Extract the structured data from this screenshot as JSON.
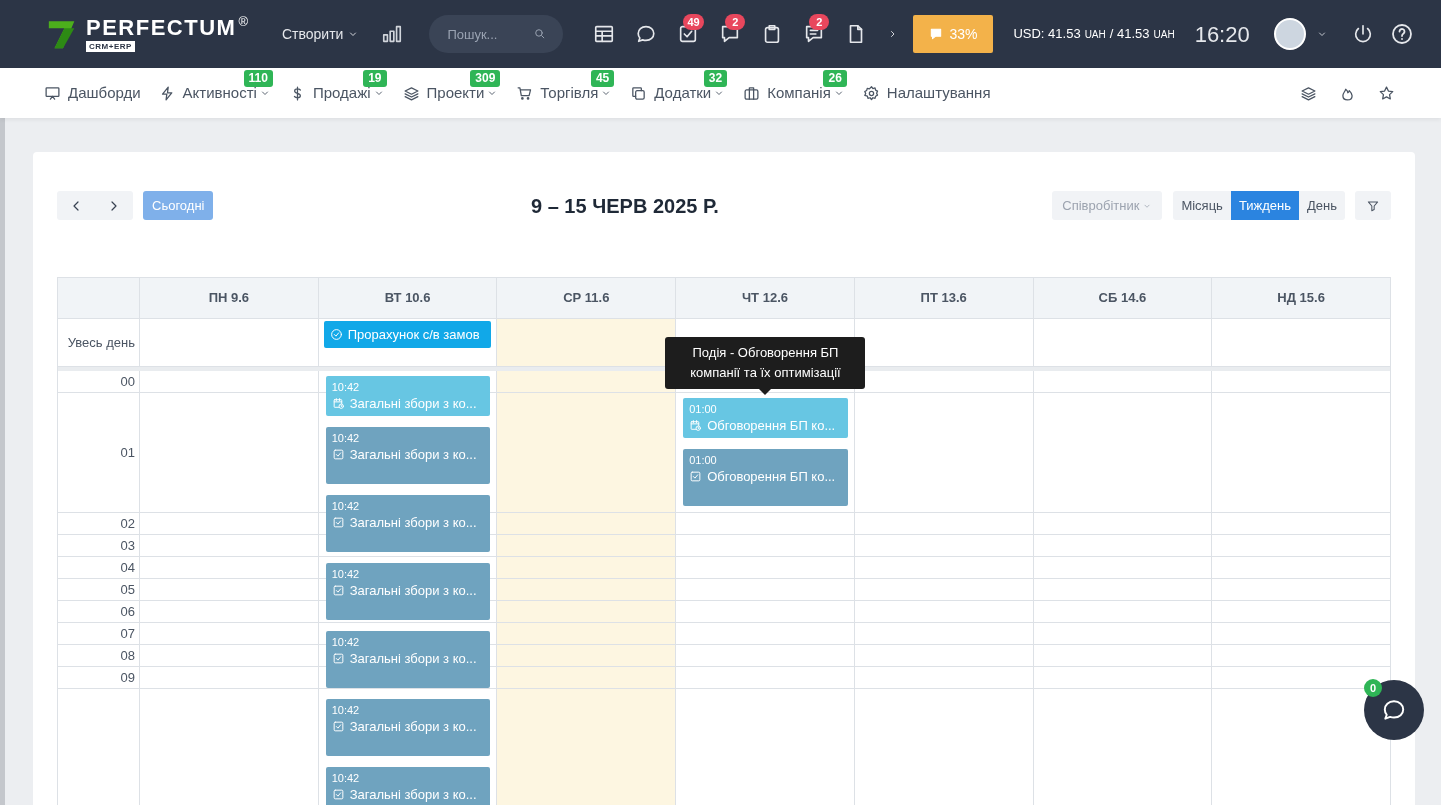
{
  "header": {
    "brand": "PERFECTUM",
    "brand_mark": "®",
    "brand_sub": "CRM+ERP",
    "create": "Створити",
    "search": {
      "placeholder": "Пошук..."
    },
    "icons": [
      {
        "kind": "table"
      },
      {
        "kind": "chat"
      },
      {
        "kind": "tasks",
        "badge": "49"
      },
      {
        "kind": "messages",
        "badge": "2"
      },
      {
        "kind": "clipboard"
      },
      {
        "kind": "notes",
        "badge": "2"
      },
      {
        "kind": "file"
      },
      {
        "kind": "more"
      }
    ],
    "progress": "33%",
    "currency": [
      {
        "amount": "USD: 41.53",
        "unit": "UAH"
      },
      {
        "amount": "/ 41.53",
        "unit": "UAH"
      }
    ],
    "time": "16:20"
  },
  "nav": [
    {
      "kind": "dashboard",
      "label": "Дашборди",
      "dropdown": false
    },
    {
      "kind": "bolt",
      "label": "Активності",
      "badge": "110",
      "dropdown": true
    },
    {
      "kind": "dollar",
      "label": "Продажі",
      "badge": "19",
      "dropdown": true
    },
    {
      "kind": "layers",
      "label": "Проекти",
      "badge": "309",
      "dropdown": true
    },
    {
      "kind": "cart",
      "label": "Торгівля",
      "badge": "45",
      "dropdown": true
    },
    {
      "kind": "copy",
      "label": "Додатки",
      "badge": "32",
      "dropdown": true
    },
    {
      "kind": "briefcase",
      "label": "Компанія",
      "badge": "26",
      "dropdown": true
    },
    {
      "kind": "gear",
      "label": "Налаштування",
      "dropdown": false
    }
  ],
  "calendar": {
    "today_button": "Сьогодні",
    "title": "9 – 15 ЧЕРВ 2025 Р.",
    "employee_filter": "Співробітник",
    "views": [
      {
        "label": "Місяць",
        "selected": false
      },
      {
        "label": "Тиждень",
        "selected": true
      },
      {
        "label": "День",
        "selected": false
      }
    ],
    "all_day_label": "Увесь день",
    "days": [
      {
        "label": "ПН 9.6",
        "today": false
      },
      {
        "label": "ВТ 10.6",
        "today": false,
        "all_day": [
          {
            "kind": "task",
            "title": "Прорахунок с/в замов"
          }
        ]
      },
      {
        "label": "СР 11.6",
        "today": true
      },
      {
        "label": "ЧТ 12.6",
        "today": false
      },
      {
        "label": "ПТ 13.6",
        "today": false
      },
      {
        "label": "СБ 14.6",
        "today": false
      },
      {
        "label": "НД 15.6",
        "today": false
      }
    ],
    "hours": [
      {
        "label": "00",
        "columns": [
          null,
          {
            "events": [
              {
                "kind": "event",
                "time": "10:42",
                "title": "Загальні збори з ко..."
              },
              {
                "kind": "task",
                "time": "10:42",
                "title": "Загальні збори з ко..."
              },
              {
                "kind": "task",
                "time": "10:42",
                "title": "Загальні збори з ко..."
              },
              {
                "kind": "task",
                "time": "10:42",
                "title": "Загальні збори з ко..."
              },
              {
                "kind": "task",
                "time": "10:42",
                "title": "Загальні збори з ко..."
              },
              {
                "kind": "task",
                "time": "10:42",
                "title": "Загальні збори з ко..."
              },
              {
                "kind": "task",
                "time": "10:42",
                "title": "Загальні збори з ко..."
              }
            ]
          },
          null,
          null,
          null,
          null,
          null
        ]
      },
      {
        "label": "01",
        "columns": [
          null,
          null,
          null,
          {
            "events": [
              {
                "kind": "event",
                "time": "01:00",
                "title": "Обговорення БП ко...",
                "tooltip": "Подія - Обговорення БП компанії та їх оптимізації"
              },
              {
                "kind": "task",
                "time": "01:00",
                "title": "Обговорення БП ко..."
              }
            ]
          },
          null,
          null,
          null
        ]
      },
      {
        "label": "02"
      },
      {
        "label": "03"
      },
      {
        "label": "04"
      },
      {
        "label": "05"
      },
      {
        "label": "06"
      },
      {
        "label": "07"
      },
      {
        "label": "08"
      },
      {
        "label": "09"
      }
    ]
  },
  "chat_button": {
    "badge": "0"
  }
}
